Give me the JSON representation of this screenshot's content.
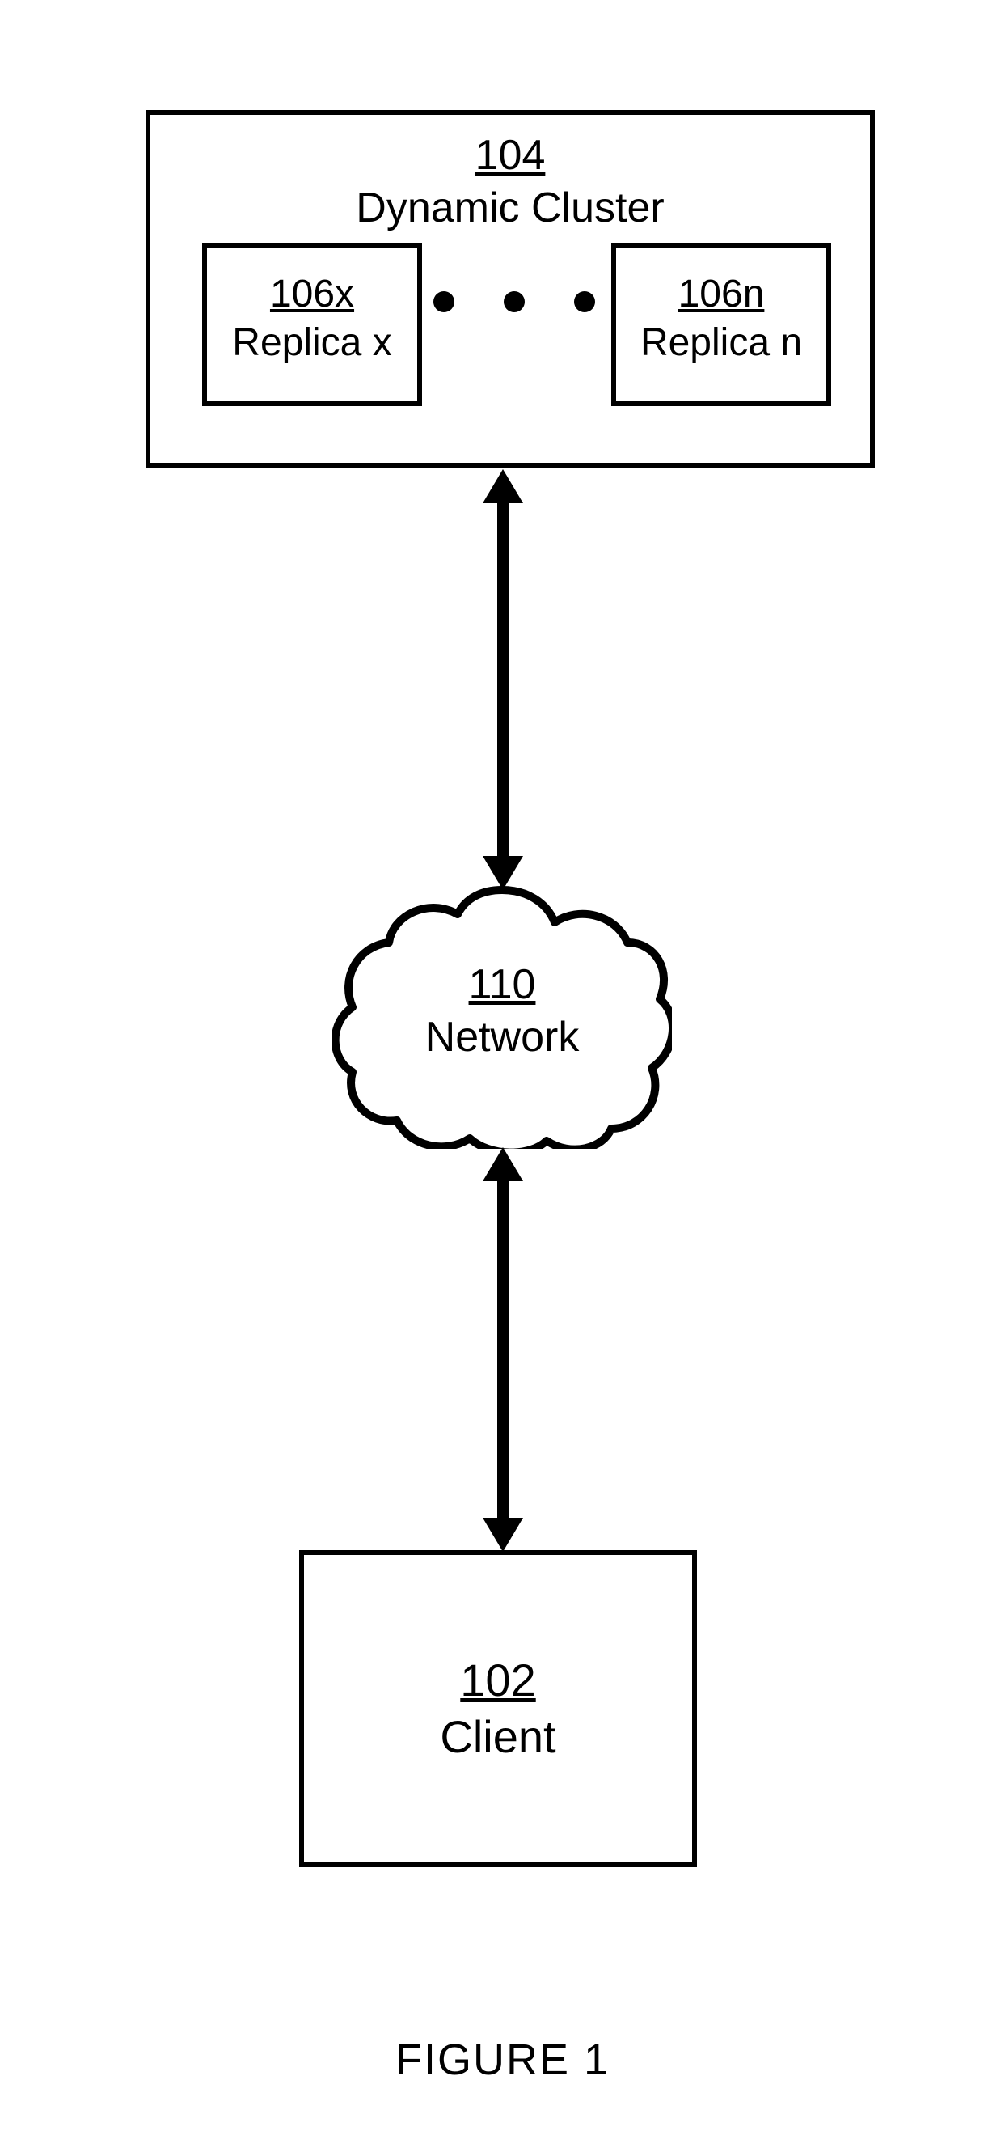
{
  "cluster": {
    "ref": "104",
    "label": "Dynamic Cluster"
  },
  "replica_left": {
    "ref": "106x",
    "label": "Replica x"
  },
  "replica_right": {
    "ref": "106n",
    "label": "Replica n"
  },
  "network": {
    "ref": "110",
    "label": "Network"
  },
  "client": {
    "ref": "102",
    "label": "Client"
  },
  "caption": "FIGURE 1"
}
